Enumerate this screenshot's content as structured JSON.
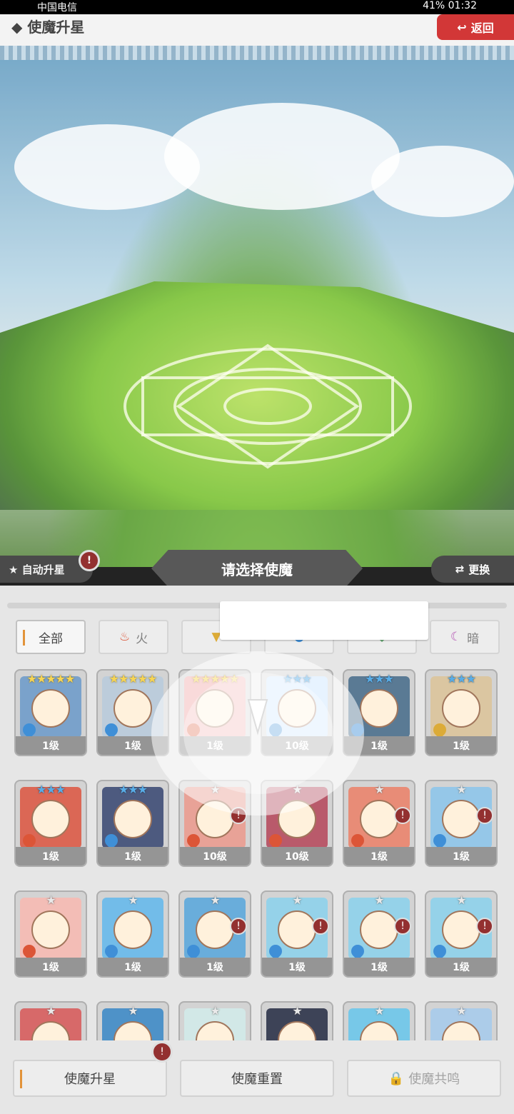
{
  "statusbar": {
    "carrier": "中国电信",
    "right": "41% 01:32"
  },
  "header": {
    "title": "◆ 使魔升星",
    "back": "返回"
  },
  "strip": {
    "auto_upgrade": "★ 自动升星",
    "hint": "请选择使魔",
    "swap": "更换"
  },
  "tabs": [
    {
      "label": "全部",
      "icon": "all"
    },
    {
      "label": "火",
      "icon": "fire-icon"
    },
    {
      "label": "",
      "icon": "earth-icon"
    },
    {
      "label": "",
      "icon": "water-icon"
    },
    {
      "label": "",
      "icon": "wind-icon"
    },
    {
      "label": "暗",
      "icon": "dark-icon"
    }
  ],
  "cards": [
    {
      "stars": "★★★★★",
      "star_color": "gold",
      "element": "water",
      "level": "1级",
      "art": "#6f9bc7",
      "warn": false
    },
    {
      "stars": "★★★★★",
      "star_color": "gold",
      "element": "water",
      "level": "1级",
      "art": "#b7c8d8",
      "warn": false
    },
    {
      "stars": "★★★★★",
      "star_color": "gold",
      "element": "fire",
      "level": "1级",
      "art": "#f0a6a6",
      "warn": false
    },
    {
      "stars": "★★★",
      "star_color": "blue",
      "element": "water",
      "level": "10级",
      "art": "#c7e2ff",
      "warn": false
    },
    {
      "stars": "★★★",
      "star_color": "blue",
      "element": "water",
      "level": "1级",
      "art": "#4d6f8b",
      "warn": false
    },
    {
      "stars": "★★★",
      "star_color": "blue",
      "element": "earth",
      "level": "1级",
      "art": "#d8c29a",
      "warn": false
    },
    {
      "stars": "★★★",
      "star_color": "blue",
      "element": "fire",
      "level": "1级",
      "art": "#d85b47",
      "warn": false
    },
    {
      "stars": "★★★",
      "star_color": "blue",
      "element": "water",
      "level": "1级",
      "art": "#3e4c75",
      "warn": false
    },
    {
      "stars": "★",
      "star_color": "gray",
      "element": "fire",
      "level": "10级",
      "art": "#e79b8f",
      "warn": true
    },
    {
      "stars": "★",
      "star_color": "gray",
      "element": "fire",
      "level": "10级",
      "art": "#b44d5f",
      "warn": false
    },
    {
      "stars": "★",
      "star_color": "gray",
      "element": "fire",
      "level": "1级",
      "art": "#e6836c",
      "warn": true
    },
    {
      "stars": "★",
      "star_color": "gray",
      "element": "water",
      "level": "1级",
      "art": "#8dc3e6",
      "warn": true
    },
    {
      "stars": "★",
      "star_color": "gray",
      "element": "fire",
      "level": "1级",
      "art": "#f2b8b0",
      "warn": false
    },
    {
      "stars": "★",
      "star_color": "gray",
      "element": "water",
      "level": "1级",
      "art": "#66b7e8",
      "warn": false
    },
    {
      "stars": "★",
      "star_color": "gray",
      "element": "water",
      "level": "1级",
      "art": "#5da6d8",
      "warn": true
    },
    {
      "stars": "★",
      "star_color": "gray",
      "element": "water",
      "level": "1级",
      "art": "#8ccfe8",
      "warn": true
    },
    {
      "stars": "★",
      "star_color": "gray",
      "element": "water",
      "level": "1级",
      "art": "#8ccfe8",
      "warn": true
    },
    {
      "stars": "★",
      "star_color": "gray",
      "element": "water",
      "level": "1级",
      "art": "#8ccfe8",
      "warn": true
    },
    {
      "stars": "★",
      "star_color": "gray",
      "element": "fire",
      "level": "",
      "art": "#d45d5d",
      "warn": false
    },
    {
      "stars": "★",
      "star_color": "gray",
      "element": "water",
      "level": "",
      "art": "#3f89c4",
      "warn": false
    },
    {
      "stars": "★",
      "star_color": "gray",
      "element": "water",
      "level": "",
      "art": "#cfe7e5",
      "warn": false
    },
    {
      "stars": "★",
      "star_color": "gray",
      "element": "water",
      "level": "",
      "art": "#2d3349",
      "warn": false
    },
    {
      "stars": "★",
      "star_color": "gray",
      "element": "water",
      "level": "",
      "art": "#6cc4e6",
      "warn": false
    },
    {
      "stars": "★",
      "star_color": "gray",
      "element": "water",
      "level": "",
      "art": "#a5c8e8",
      "warn": false
    }
  ],
  "bottom": {
    "upgrade": "使魔升星",
    "reset": "使魔重置",
    "resonance": "使魔共鸣"
  },
  "warn_mark": "!"
}
